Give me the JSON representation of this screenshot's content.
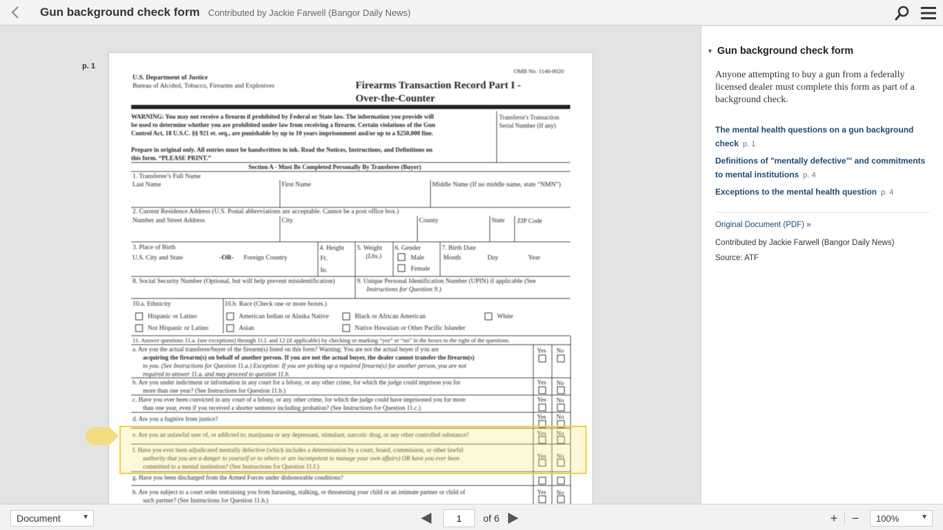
{
  "header": {
    "title": "Gun background check form",
    "contributor": "Contributed by Jackie Farwell (Bangor Daily News)"
  },
  "viewer": {
    "page_label": "p. 1"
  },
  "form": {
    "omb": "OMB No. 1140-0020",
    "dept": "U.S. Department of Justice",
    "bureau": "Bureau of Alcohol, Tobacco, Firearms and Explosives",
    "title1": "Firearms Transaction Record Part I -",
    "title2": "Over-the-Counter",
    "warning1": "WARNING:  You may not receive a firearm if prohibited by Federal or State law.  The information you provide will",
    "warning2": "be used to determine whether you are prohibited under law from receiving a firearm.  Certain violations of the Gun",
    "warning3": "Control Act, 18 U.S.C. §§ 921 et. seq., are punishable by up to 10 years imprisonment and/or up to a $250,000 fine.",
    "prepare1": "Prepare in original only.  All entries must be handwritten in ink.  Read the Notices, Instructions, and Definitions on",
    "prepare2": "this form. “PLEASE PRINT.”",
    "serial1": "Transferor's Transaction",
    "serial2": "Serial Number (If any)",
    "section_a": "Section A - Must Be Completed Personally By Transferee (Buyer)",
    "q1": "1.   Transferee’s Full Name",
    "last_name": "Last Name",
    "first_name": "First Name",
    "middle_name": "Middle Name (If no middle name, state “NMN”)",
    "q2": "2.   Current Residence Address  (U.S. Postal abbreviations are acceptable.  Cannot be a post office box.)",
    "street": "Number and Street Address",
    "city": "City",
    "county": "County",
    "state": "State",
    "zip": "ZIP Code",
    "q3": "3.   Place of Birth",
    "us_city": "U.S. City and State",
    "or": "-OR-",
    "foreign": "Foreign Country",
    "q4": "4.  Height",
    "ft": "Ft.",
    "in": "In.",
    "q5": "5.  Weight",
    "lbs": "(Lbs.)",
    "q6": "6.  Gender",
    "male": "Male",
    "female": "Female",
    "q7": "7.  Birth Date",
    "month": "Month",
    "day": "Day",
    "year": "Year",
    "q8": "8.   Social Security Number (Optional, but will help prevent misidentification)",
    "q9a": "9.   Unique Personal Identification Number (UPIN) if applicable (See",
    "q9b": "Instructions for Question 9.)",
    "q10a": "10.a.  Ethnicity",
    "hisp": "Hispanic or Latino",
    "nothisp": "Not Hispanic or Latino",
    "q10b": "10.b.  Race (Check one or more boxes.)",
    "amind": "American Indian or Alaska Native",
    "black": "Black or African American",
    "white": "White",
    "asian": "Asian",
    "hawaiian": "Native Hawaiian or Other Pacific Islander",
    "q11": "11.  Answer questions 11.a. (see exceptions) through 11.l. and 12 (if applicable) by checking or marking “yes” or “no” in the boxes to the right of the questions.",
    "q11a1": "a.   Are you the actual transferee/buyer of the firearm(s) listed on this form?  Warning:  You are not the actual buyer if you are",
    "q11a2": "acquiring the firearm(s) on behalf of another person.  If you are not the actual buyer, the dealer cannot transfer the firearm(s)",
    "q11a3": "to you.  (See Instructions for Question 11.a.) Exception:  If you are picking up a repaired firearm(s) for another person, you are not",
    "q11a4": "required to answer 11.a. and may proceed to question 11.b.",
    "q11b1": "b.   Are you under indictment or information in any court for a felony, or any other crime, for which the judge could imprison you for",
    "q11b2": "more than one year?  (See Instructions for Question 11.b.)",
    "q11c1": "c.   Have you ever been convicted in any court of a felony, or any other crime, for which the judge could have imprisoned you for more",
    "q11c2": "than one year, even if you received a shorter sentence including probation?  (See Instructions for Question 11.c.)",
    "q11d": "d.   Are you a fugitive from justice?",
    "q11e": "e.   Are you an unlawful user of, or addicted to, marijuana or any depressant, stimulant, narcotic drug, or any other controlled substance?",
    "q11f1": "f.   Have you ever been adjudicated mentally defective (which includes a determination by a court, board, commission, or other lawful",
    "q11f2": "authority that you are a danger to yourself or to others or are incompetent to manage your own affairs) OR have you ever been",
    "q11f3": "committed to a mental institution?  (See Instructions for Question 11.f.)",
    "q11g": "g.   Have you been discharged from the Armed Forces under dishonorable conditions?",
    "q11h1": "h.   Are you subject to a court order restraining you from harassing, stalking, or threatening your child or an intimate partner or child of",
    "q11h2": "such partner?  (See Instructions for Question 11.h.)",
    "yes": "Yes",
    "no": "No"
  },
  "sidebar": {
    "title": "Gun background check form",
    "description": "Anyone attempting to buy a gun from a federally licensed dealer must complete this form as part of a background check.",
    "notes": [
      {
        "title": "The mental health questions on a gun background check",
        "page": "p. 1"
      },
      {
        "title": "Definitions of \"mentally defective\"' and commitments to mental institutions",
        "page": "p. 4"
      },
      {
        "title": "Exceptions to the mental health question",
        "page": "p. 4"
      }
    ],
    "original_link": "Original Document (PDF) »",
    "contributor": "Contributed by Jackie Farwell (Bangor Daily News)",
    "source": "Source: ATF"
  },
  "footer": {
    "view_mode": "Document",
    "page_value": "1",
    "page_of": "of 6",
    "zoom_in": "+",
    "zoom_out": "−",
    "zoom_value": "100%"
  },
  "colors": {
    "highlight_border": "#f2d03c",
    "link": "#1b4a72"
  }
}
